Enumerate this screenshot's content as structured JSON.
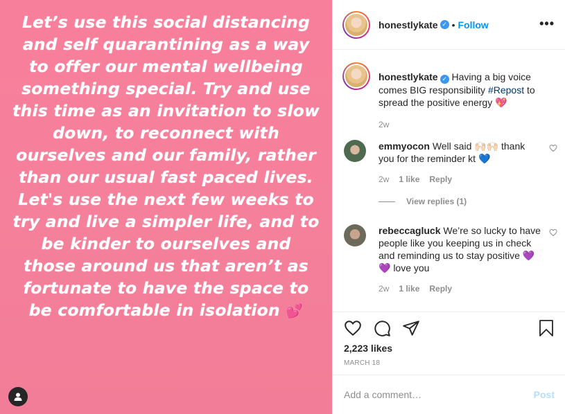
{
  "post": {
    "text": "Let’s use this social distancing and self quarantining as a way to offer our mental wellbeing something special. Try and use this time as an invitation to slow down, to reconnect with ourselves and our family, rather than our usual fast paced lives. Let's use the next few weeks to try and live a simpler life, and to be kinder to ourselves and those around us that aren’t as fortunate to have the space to be comfortable in isolation",
    "text_emoji": "💕",
    "background_color": "#f5809b"
  },
  "header": {
    "username": "honestlykate",
    "separator": "•",
    "follow_label": "Follow",
    "more_label": "•••"
  },
  "caption": {
    "username": "honestlykate",
    "text_before": "Having a big voice comes BIG responsibility ",
    "hashtag": "#Repost",
    "text_after": " to spread the positive energy 💖",
    "time": "2w"
  },
  "comments": [
    {
      "username": "emmyocon",
      "text": "Well said 🙌🏻🙌🏻 thank you for the reminder kt 💙",
      "time": "2w",
      "likes": "1 like",
      "reply_label": "Reply"
    },
    {
      "username": "rebeccagluck",
      "text": "We’re so lucky to have people like you keeping us in check and reminding us to stay positive 💜💜 love you",
      "time": "2w",
      "likes": "1 like",
      "reply_label": "Reply"
    }
  ],
  "view_replies_label": "View replies (1)",
  "likes_count": "2,223 likes",
  "date": "MARCH 18",
  "add_comment": {
    "placeholder": "Add a comment…",
    "post_label": "Post"
  },
  "colors": {
    "accent": "#0095f6",
    "verified": "#3897f0",
    "muted": "#8e8e8e"
  }
}
